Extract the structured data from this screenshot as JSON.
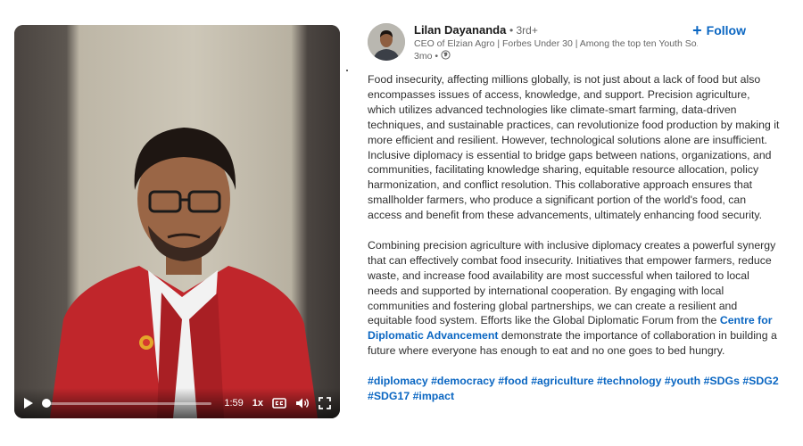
{
  "video": {
    "time": "1:59",
    "speed": "1x",
    "progress_fraction": 0.0
  },
  "post": {
    "author_name": "Lilan Dayananda",
    "degree": "• 3rd+",
    "headline": "CEO of Elzian Agro | Forbes Under 30 | Among the top ten Youth So...",
    "time_ago": "3mo •",
    "follow_label": "Follow",
    "follow_plus": "+",
    "paragraph1": "Food insecurity, affecting millions globally, is not just about a lack of food but also encompasses issues of access, knowledge, and support. Precision agriculture, which utilizes advanced technologies like climate-smart farming, data-driven techniques, and sustainable practices, can revolutionize food production by making it more efficient and resilient. However, technological solutions alone are insufficient. Inclusive diplomacy is essential to bridge gaps between nations, organizations, and communities, facilitating knowledge sharing, equitable resource allocation, policy harmonization, and conflict resolution. This collaborative approach ensures that smallholder farmers, who produce a significant portion of the world's food, can access and benefit from these advancements, ultimately enhancing food security.",
    "paragraph2_before_link": "Combining precision agriculture with inclusive diplomacy creates a powerful synergy that can effectively combat food insecurity. Initiatives that empower farmers, reduce waste, and increase food availability are most successful when tailored to local needs and supported by international cooperation. By engaging with local communities and fostering global partnerships, we can create a resilient and equitable food system. Efforts like the Global Diplomatic Forum from the ",
    "paragraph2_link": "Centre for Diplomatic Advancement",
    "paragraph2_after_link": " demonstrate the importance of collaboration in building a future where everyone has enough to eat and no one goes to bed hungry.",
    "hashtags": [
      "#diplomacy",
      "#democracy",
      "#food",
      "#agriculture",
      "#technology",
      "#youth",
      "#SDGs",
      "#SDG2",
      "#SDG17",
      "#impact"
    ]
  },
  "colors": {
    "link": "#0a66c2",
    "jacket": "#c0262b",
    "wall": "#c9c2b2"
  }
}
